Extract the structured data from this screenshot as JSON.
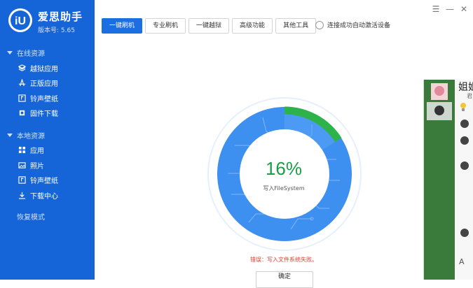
{
  "app": {
    "name": "爱思助手",
    "version": "版本号: 5.65"
  },
  "sidebar": {
    "online_section": "在线资源",
    "online_items": [
      {
        "label": "越狱应用",
        "icon": "box-icon"
      },
      {
        "label": "正版应用",
        "icon": "app-store-icon"
      },
      {
        "label": "铃声壁纸",
        "icon": "ringtone-icon"
      },
      {
        "label": "固件下载",
        "icon": "firmware-icon"
      }
    ],
    "local_section": "本地资源",
    "local_items": [
      {
        "label": "应用",
        "icon": "apps-grid-icon"
      },
      {
        "label": "照片",
        "icon": "photo-icon"
      },
      {
        "label": "铃声壁纸",
        "icon": "ringtone-icon"
      },
      {
        "label": "下载中心",
        "icon": "download-icon"
      }
    ],
    "recovery": "恢复模式"
  },
  "toolbar": {
    "tabs": [
      "一键刷机",
      "专业刷机",
      "一键越狱",
      "高级功能",
      "其他工具"
    ],
    "active_tab": "一键刷机",
    "auto_activate_label": "连接成功自动激活设备"
  },
  "window_controls": {
    "menu": "☰",
    "minimize": "—",
    "close": "✕"
  },
  "progress": {
    "percent_text": "16%",
    "value": 0.16,
    "status": "写入FileSystem",
    "error": "错误：写入文件系统失败。",
    "button": "确定"
  },
  "chat_window": {
    "name": "姐姐",
    "subtitle": "君"
  },
  "colors": {
    "sidebar": "#1565d8",
    "accent": "#1b6fe0",
    "progress_green": "#2db34a",
    "dial_blue": "#3d8ff0",
    "error": "#e23b2e"
  }
}
